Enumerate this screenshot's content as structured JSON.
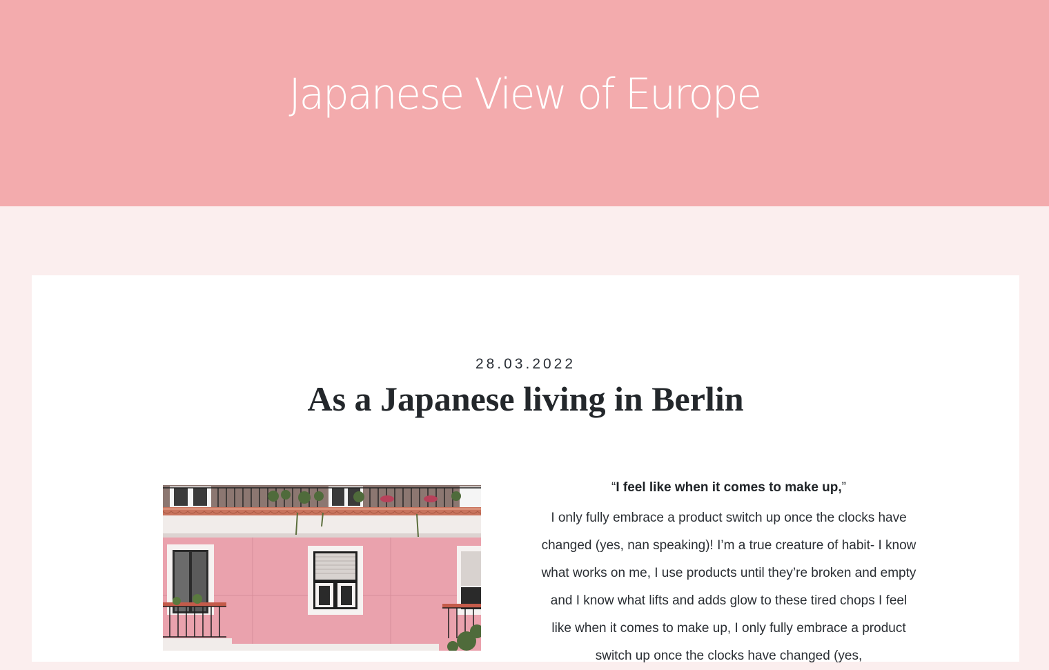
{
  "header": {
    "site_title": "Japanese View of Europe"
  },
  "post": {
    "date": "28.03.2022",
    "title": "As a Japanese living in Berlin",
    "quote_open": "“",
    "quote_text": "I feel like when it comes to make up,",
    "quote_close": "”",
    "body": "I only fully embrace a product switch up once the clocks have changed (yes, nan speaking)! I’m a true creature of habit- I know what works on me, I use products until they’re broken and empty and I know what lifts and adds glow to these tired chops I feel like when it comes to make up, I only fully embrace a product switch up once the clocks have changed (yes,",
    "image_label": "pink-building-photo"
  },
  "colors": {
    "hero_bg": "#f3abad",
    "page_bg": "#fbeeee",
    "card_bg": "#ffffff",
    "text_dark": "#23272b"
  }
}
